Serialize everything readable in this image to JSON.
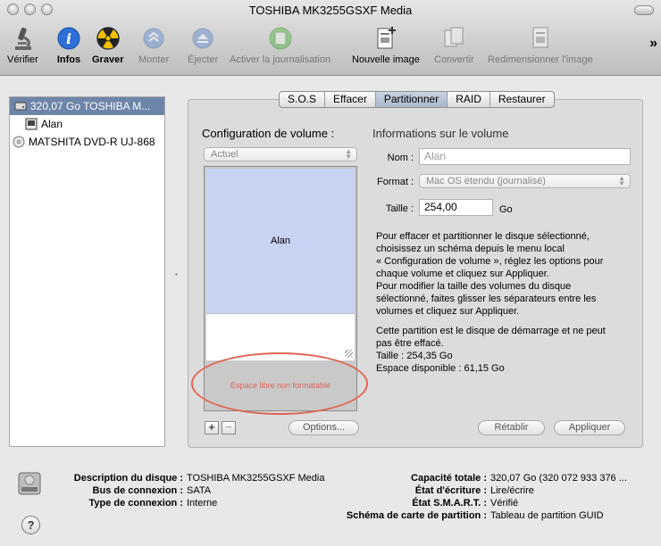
{
  "window": {
    "title": "TOSHIBA MK3255GSXF Media"
  },
  "toolbar": {
    "items": [
      {
        "label": "Vérifier",
        "icon": "microscope-icon",
        "enabled": true
      },
      {
        "label": "Infos",
        "icon": "info-icon",
        "enabled": true
      },
      {
        "label": "Graver",
        "icon": "burn-icon",
        "enabled": true
      },
      {
        "label": "Monter",
        "icon": "mount-icon",
        "enabled": false
      },
      {
        "label": "Éjecter",
        "icon": "eject-icon",
        "enabled": false
      },
      {
        "label": "Activer la journalisation",
        "icon": "journaling-icon",
        "enabled": false
      },
      {
        "label": "Nouvelle image",
        "icon": "new-image-icon",
        "enabled": true
      },
      {
        "label": "Convertir",
        "icon": "convert-icon",
        "enabled": false
      },
      {
        "label": "Redimensionner l'image",
        "icon": "resize-image-icon",
        "enabled": false
      }
    ],
    "overflow": "»"
  },
  "sidebar": {
    "items": [
      {
        "label": "320,07 Go TOSHIBA M...",
        "icon": "hard-disk-icon",
        "selected": true
      },
      {
        "label": "Alan",
        "icon": "volume-icon",
        "selected": false
      },
      {
        "label": "MATSHITA DVD-R UJ-868",
        "icon": "optical-drive-icon",
        "selected": false
      }
    ]
  },
  "tabs": [
    "S.O.S",
    "Effacer",
    "Partitionner",
    "RAID",
    "Restaurer"
  ],
  "selected_tab": "Partitionner",
  "partition": {
    "config_heading": "Configuration de volume :",
    "scheme_value": "Actuel",
    "volume_name": "Alan",
    "free_space_label": "Espace libre non formatable",
    "add": "+",
    "remove": "−",
    "options_button": "Options...",
    "info_heading": "Informations sur le volume",
    "name_label": "Nom :",
    "name_value": "Alan",
    "format_label": "Format :",
    "format_value": "Mac OS étendu (journalisé)",
    "size_label": "Taille :",
    "size_value": "254,00",
    "size_unit": "Go",
    "instructions": [
      "Pour effacer et partitionner le disque sélectionné,",
      "choisissez un schéma depuis le menu local",
      "« Configuration de volume », réglez les options pour",
      "chaque volume et cliquez sur Appliquer.",
      "Pour modifier la taille des volumes du disque",
      "sélectionné, faites glisser les séparateurs entre les",
      "volumes et cliquez sur Appliquer."
    ],
    "status": [
      "Cette partition est le disque de démarrage et ne peut",
      "pas être effacé.",
      "Taille : 254,35 Go",
      "Espace disponible : 61,15 Go"
    ],
    "revert_button": "Rétablir",
    "apply_button": "Appliquer"
  },
  "footer": {
    "left": [
      {
        "key": "Description du disque :",
        "value": "TOSHIBA MK3255GSXF Media"
      },
      {
        "key": "Bus de connexion :",
        "value": "SATA"
      },
      {
        "key": "Type de connexion :",
        "value": "Interne"
      }
    ],
    "right": [
      {
        "key": "Capacité totale :",
        "value": "320,07 Go (320 072 933 376 ..."
      },
      {
        "key": "État d'écriture :",
        "value": "Lire/écrire"
      },
      {
        "key": "État S.M.A.R.T. :",
        "value": "Vérifié"
      },
      {
        "key": "Schéma de carte de partition :",
        "value": "Tableau de partition GUID"
      }
    ],
    "help": "?"
  }
}
